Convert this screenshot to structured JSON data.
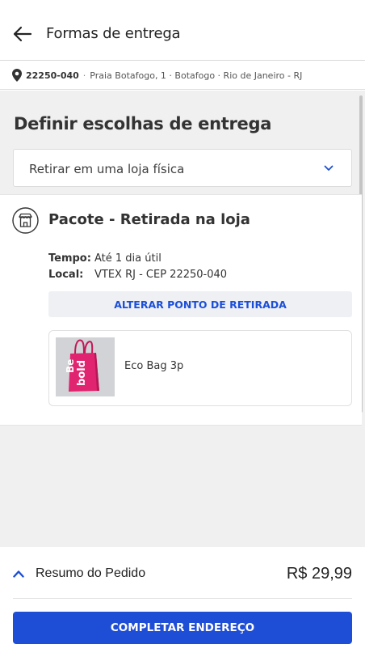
{
  "header": {
    "title": "Formas de entrega",
    "back_icon": "arrow-left-icon"
  },
  "address": {
    "cep": "22250-040",
    "separator": "·",
    "full": "Praia Botafogo, 1 · Botafogo · Rio de Janeiro - RJ",
    "icon": "map-pin-icon"
  },
  "delivery": {
    "heading": "Definir escolhas de entrega",
    "select_value": "Retirar em uma loja física"
  },
  "package": {
    "title": "Pacote - Retirada na loja",
    "store_icon": "store-icon",
    "time_label": "Tempo:",
    "time_value": "Até 1 dia útil",
    "location_label": "Local:",
    "location_value": "VTEX RJ - CEP 22250-040",
    "change_button": "ALTERAR PONTO DE RETIRADA",
    "product": {
      "name": "Eco Bag 3p",
      "bag_text_1": "Be",
      "bag_text_2": "bold"
    }
  },
  "footer": {
    "summary_label": "Resumo do Pedido",
    "total": "R$ 29,99",
    "cta": "COMPLETAR ENDEREÇO"
  },
  "colors": {
    "accent": "#1f4ed6",
    "link": "#1c4fd8",
    "background": "#f0f0f1",
    "bag": "#e0246f"
  }
}
